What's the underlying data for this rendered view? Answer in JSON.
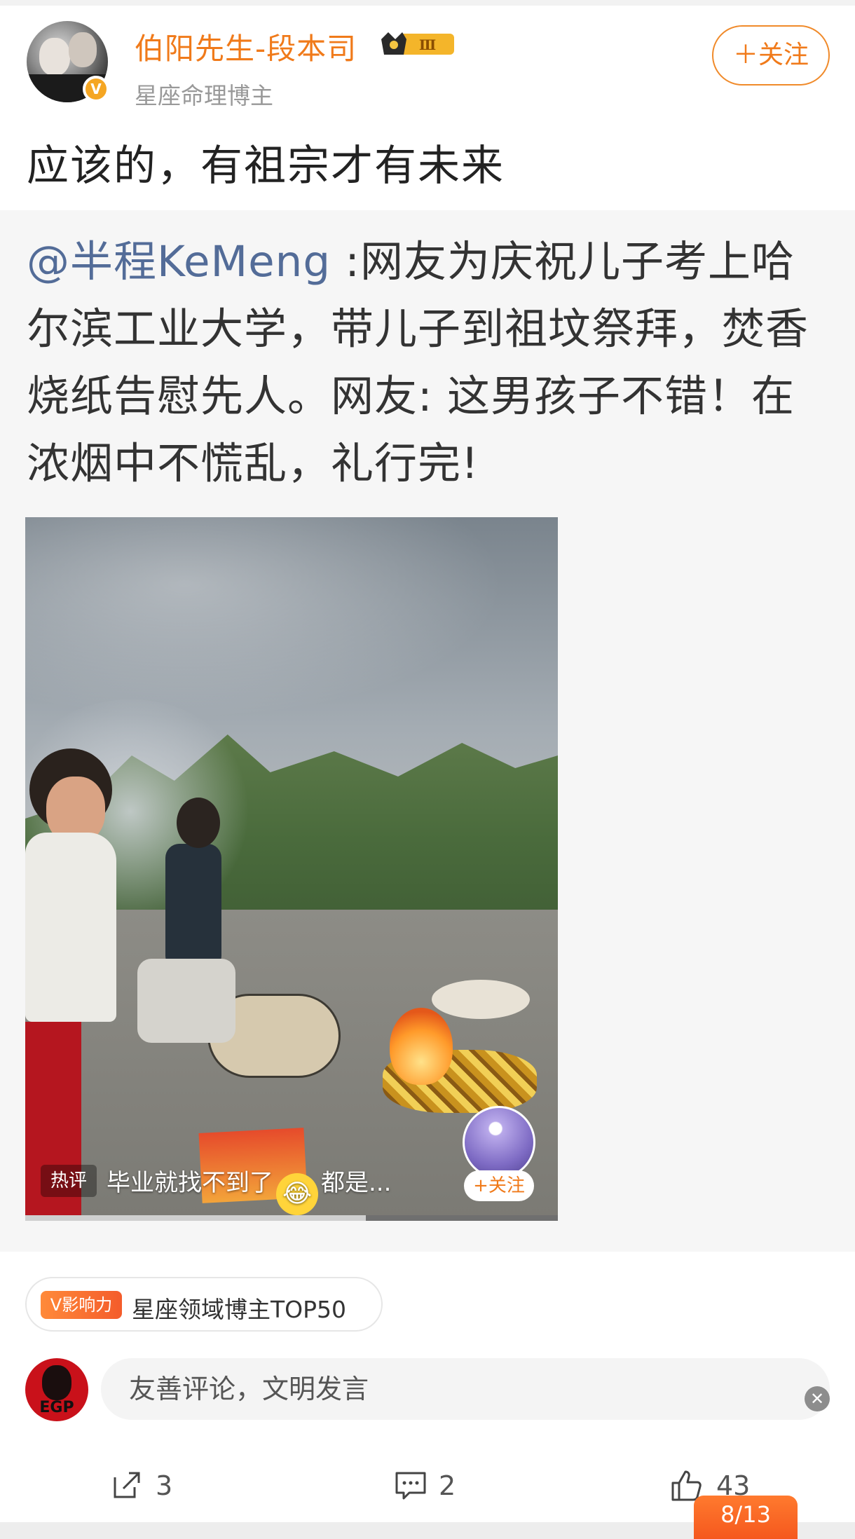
{
  "header": {
    "username": "伯阳先生-段本司",
    "level_badge": "Ⅲ",
    "subtitle": "星座命理博主",
    "follow_label": "＋关注",
    "verified_icon": "v-badge-icon",
    "accent_color": "#f07a1a"
  },
  "post": {
    "text": "应该的，有祖宗才有未来"
  },
  "repost": {
    "mention": "@半程KeMeng",
    "text": " :网友为庆祝儿子考上哈尔滨工业大学，带儿子到祖坟祭拜，焚香烧纸告慰先人。网友: 这男孩子不错！在浓烟中不慌乱，礼行完!",
    "mention_color": "#536c98"
  },
  "video": {
    "hot_tag": "热评",
    "hot_comment_before": "毕业就找不到了",
    "hot_comment_emoji": "😂",
    "hot_comment_after": "都是...",
    "follow_label": "+关注",
    "progress": 0.64
  },
  "influence": {
    "badge": "V影响力",
    "text": "星座领域博主TOP50"
  },
  "comment": {
    "placeholder": "友善评论，文明发言",
    "avatar_text": "EGP"
  },
  "actions": {
    "repost_count": "3",
    "comment_count": "2",
    "like_count": "43"
  },
  "page_counter": "8/13"
}
